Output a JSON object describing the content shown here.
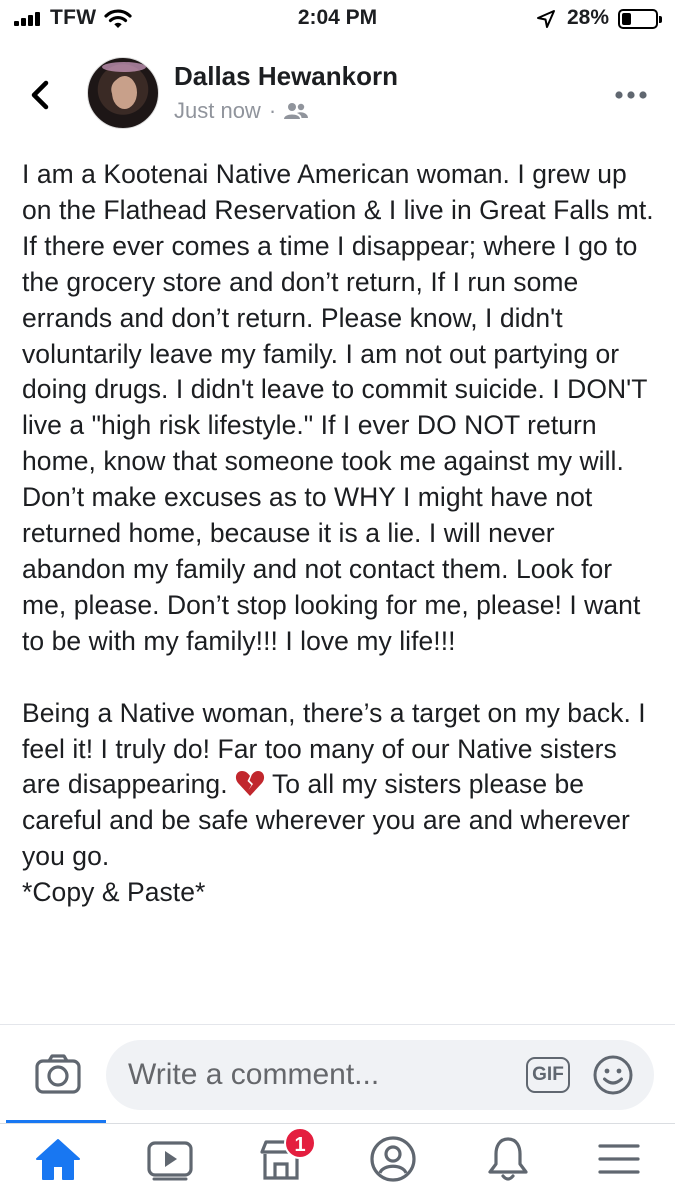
{
  "status_bar": {
    "carrier": "TFW",
    "time": "2:04 PM",
    "battery_percent": "28%",
    "battery_level": 0.28,
    "icons": [
      "signal-icon",
      "wifi-icon",
      "location-arrow-icon",
      "battery-icon"
    ]
  },
  "post": {
    "author": "Dallas Hewankorn",
    "timestamp": "Just now",
    "separator": "·",
    "audience_icon": "friends-icon",
    "body_part1": "I am a Kootenai Native American woman.  I grew up on the Flathead Reservation & I live in Great Falls mt. If there ever comes a time I disappear; where I go to the grocery store and don’t return, If I run some errands and don’t return. Please know, I didn't voluntarily leave my family. I am not out partying or doing drugs. I didn't leave to commit suicide. I DON'T live a \"high risk lifestyle.\" If I ever DO NOT return home, know that someone took me against my will. Don’t make excuses as to WHY I might have not returned home, because it is a lie. I will never abandon my family and not contact them. Look for me, please. Don’t stop looking for me, please!  I want to be with my family!!! I love my life!!!\n\nBeing a Native woman, there’s a target on my back. I feel it! I truly do! Far too many of our Native sisters are disappearing. ",
    "emoji": "broken-heart-icon",
    "body_part2": " To all my sisters please be careful and be safe wherever you are and wherever you go.\n*Copy & Paste*"
  },
  "comment_bar": {
    "placeholder": "Write a comment...",
    "gif_label": "GIF",
    "icons": [
      "camera-icon",
      "emoji-icon"
    ]
  },
  "tab_bar": {
    "tabs": [
      "home-icon",
      "watch-icon",
      "marketplace-icon",
      "profile-icon",
      "notifications-icon",
      "menu-icon"
    ],
    "active_tab": "home-icon",
    "marketplace_badge": "1"
  },
  "colors": {
    "accent": "#1877f2",
    "badge": "#e41e3f",
    "text": "#1c1e21",
    "muted": "#90949c"
  }
}
